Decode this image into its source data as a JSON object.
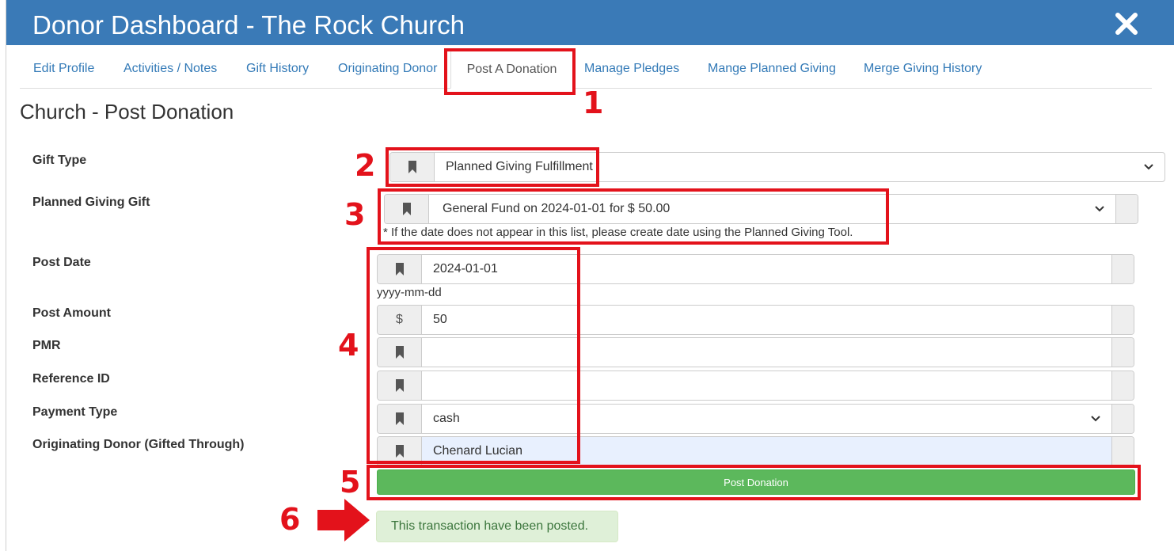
{
  "window": {
    "title": "Donor Dashboard - The Rock Church",
    "close_icon": "close-icon"
  },
  "tabs": [
    {
      "label": "Edit Profile"
    },
    {
      "label": "Activities / Notes"
    },
    {
      "label": "Gift History"
    },
    {
      "label": "Originating Donor"
    },
    {
      "label": "Post A Donation",
      "active": true
    },
    {
      "label": "Manage Pledges"
    },
    {
      "label": "Mange Planned Giving"
    },
    {
      "label": "Merge Giving History"
    }
  ],
  "section_title": "Church - Post Donation",
  "form": {
    "gift_type": {
      "label": "Gift Type",
      "value": "Planned Giving Fulfillment",
      "icon": "bookmark-icon"
    },
    "planned_gift": {
      "label": "Planned Giving Gift",
      "value": "General Fund on 2024-01-01 for $ 50.00",
      "help": "* If the date does not appear in this list, please create date using the Planned Giving Tool.",
      "icon": "bookmark-icon"
    },
    "post_date": {
      "label": "Post Date",
      "value": "2024-01-01",
      "help": "yyyy-mm-dd",
      "icon": "bookmark-icon"
    },
    "post_amount": {
      "label": "Post Amount",
      "value": "50",
      "addon": "$"
    },
    "pmr": {
      "label": "PMR",
      "value": "",
      "icon": "bookmark-icon"
    },
    "reference_id": {
      "label": "Reference ID",
      "value": "",
      "icon": "bookmark-icon"
    },
    "payment_type": {
      "label": "Payment Type",
      "value": "cash",
      "icon": "bookmark-icon"
    },
    "originating_donor": {
      "label": "Originating Donor (Gifted Through)",
      "value": "Chenard Lucian",
      "icon": "bookmark-icon"
    }
  },
  "submit_label": "Post Donation",
  "alert": "This transaction have been posted.",
  "annotations": [
    "1",
    "2",
    "3",
    "4",
    "5",
    "6"
  ],
  "colors": {
    "titlebar": "#3a7ab7",
    "link": "#337ab7",
    "success_button": "#5cb85c",
    "alert_bg": "#dff0d8",
    "alert_text": "#3c763d",
    "annotation_red": "#e3121b"
  }
}
